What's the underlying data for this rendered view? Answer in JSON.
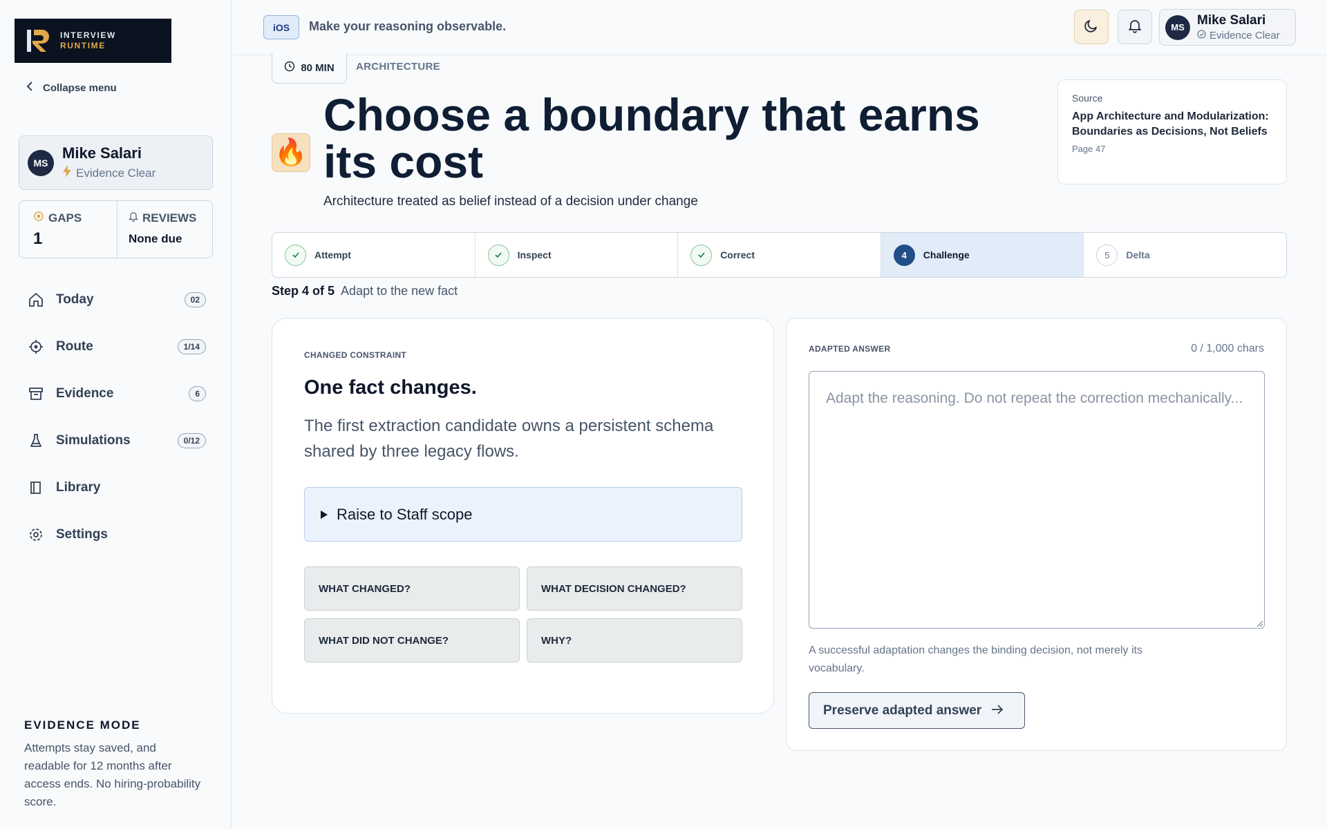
{
  "brand": {
    "line1": "INTERVIEW",
    "line2": "RUNTIME",
    "accent": "#e0a84a",
    "bg": "#0b1220"
  },
  "sidebar": {
    "collapse_label": "Collapse menu",
    "profile": {
      "initials": "MS",
      "name": "Mike Salari",
      "status": "Evidence Clear",
      "status_icon": "lightning-icon"
    },
    "stats": {
      "gaps": {
        "label": "GAPS",
        "value": "1"
      },
      "reviews": {
        "label": "REVIEWS",
        "value": "None due"
      }
    },
    "nav": [
      {
        "label": "Today",
        "badge": "02",
        "icon": "home-icon"
      },
      {
        "label": "Route",
        "badge": "1/14",
        "icon": "target-icon"
      },
      {
        "label": "Evidence",
        "badge": "6",
        "icon": "archive-icon"
      },
      {
        "label": "Simulations",
        "badge": "0/12",
        "icon": "flask-icon"
      },
      {
        "label": "Library",
        "badge": "",
        "icon": "book-icon"
      },
      {
        "label": "Settings",
        "badge": "",
        "icon": "gear-icon"
      }
    ],
    "evidence_mode": {
      "title": "EVIDENCE MODE",
      "text": "Attempts stay saved, and readable for 12 months after access ends. No hiring-probability score."
    }
  },
  "topbar": {
    "platform": "iOS",
    "tagline": "Make your reasoning observable.",
    "user": {
      "initials": "MS",
      "name": "Mike Salari",
      "status": "Evidence Clear"
    }
  },
  "lesson": {
    "duration": "80 MIN",
    "category": "ARCHITECTURE",
    "emoji": "🔥",
    "title": "Choose a boundary that earns its cost",
    "subtitle": "Architecture treated as belief instead of a decision under change",
    "source": {
      "label": "Source",
      "title": "App Architecture and Modularization: Boundaries as Decisions, Not Beliefs",
      "page": "Page 47"
    }
  },
  "stepper": {
    "steps": [
      {
        "label": "Attempt",
        "state": "done",
        "num": "1"
      },
      {
        "label": "Inspect",
        "state": "done",
        "num": "2"
      },
      {
        "label": "Correct",
        "state": "done",
        "num": "3"
      },
      {
        "label": "Challenge",
        "state": "current",
        "num": "4"
      },
      {
        "label": "Delta",
        "state": "todo",
        "num": "5"
      }
    ],
    "caption_step": "Step 4 of 5",
    "caption_text": "Adapt to the new fact"
  },
  "constraint": {
    "eyebrow": "CHANGED CONSTRAINT",
    "title": "One fact changes.",
    "body": "The first extraction candidate owns a persistent schema shared by three legacy flows.",
    "expander": "Raise to Staff scope",
    "questions": [
      "WHAT CHANGED?",
      "WHAT DECISION CHANGED?",
      "WHAT DID NOT CHANGE?",
      "WHY?"
    ]
  },
  "answer": {
    "eyebrow": "ADAPTED ANSWER",
    "count": "0 / 1,000 chars",
    "value": "",
    "placeholder": "Adapt the reasoning. Do not repeat the correction mechanically...",
    "hint": "A successful adaptation changes the binding decision, not merely its vocabulary.",
    "button": "Preserve adapted answer"
  }
}
